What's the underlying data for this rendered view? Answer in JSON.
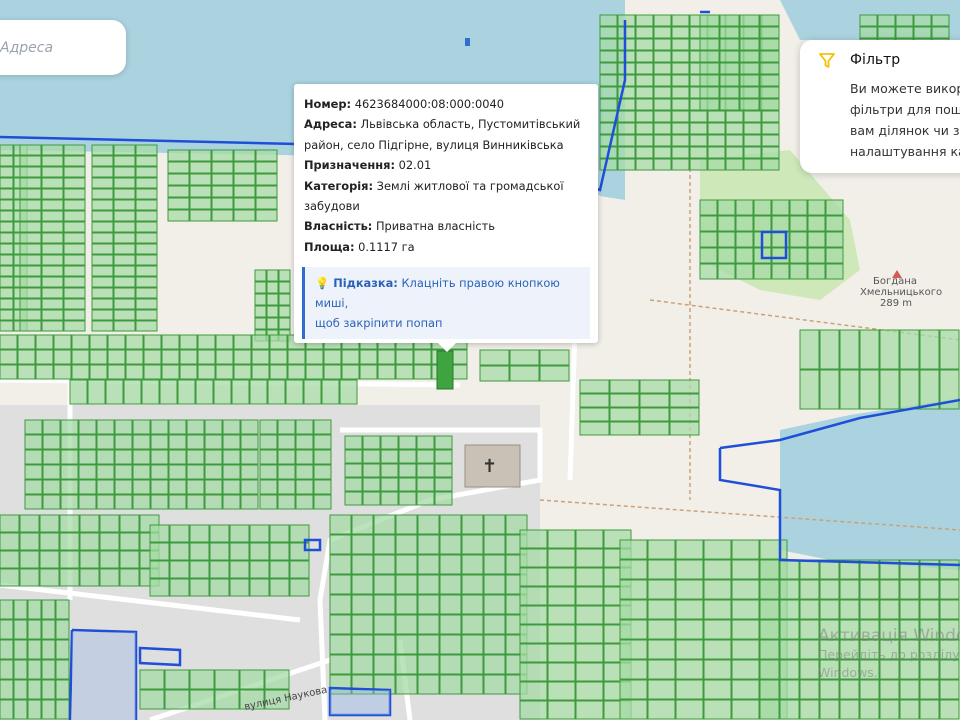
{
  "search": {
    "placeholder": "Адреса"
  },
  "popup": {
    "number_label": "Номер:",
    "number": "4623684000:08:000:0040",
    "address_label": "Адреса:",
    "address_line1": "Львівська область, Пустомитівський",
    "address_line2": "район, село Підгірне, вулиця Винниківська",
    "purpose_label": "Призначення:",
    "purpose": "02.01",
    "category_label": "Категорія:",
    "category_line1": "Землі житлової та громадської",
    "category_line2": "забудови",
    "ownership_label": "Власність:",
    "ownership": "Приватна власність",
    "area_label": "Площа:",
    "area": "0.1117 га",
    "hint_label": "Підказка:",
    "hint_line1": "Клацніть правою кнопкою миші,",
    "hint_line2": "щоб закріпити попап"
  },
  "filter": {
    "title": "Фільтр",
    "lines": [
      "Ви можете викор",
      "фільтри для пошу",
      "вам ділянок чи зі",
      "налаштування ка"
    ]
  },
  "map_labels": {
    "street": "вулиця Наукова",
    "monument_line1": "Богдана",
    "monument_line2": "Хмельницького",
    "elevation": "289 m"
  },
  "watermark": {
    "title": "Активація Windo",
    "line1": "Перейдіть до розділу",
    "line2": "Windows."
  },
  "colors": {
    "parcel_fill": "#a6dba6",
    "parcel_stroke": "#3e9a3e",
    "water": "#aad3df",
    "boundary": "#1f4fd6",
    "accent": "#f2c200",
    "hint_text": "#2a62b8"
  }
}
